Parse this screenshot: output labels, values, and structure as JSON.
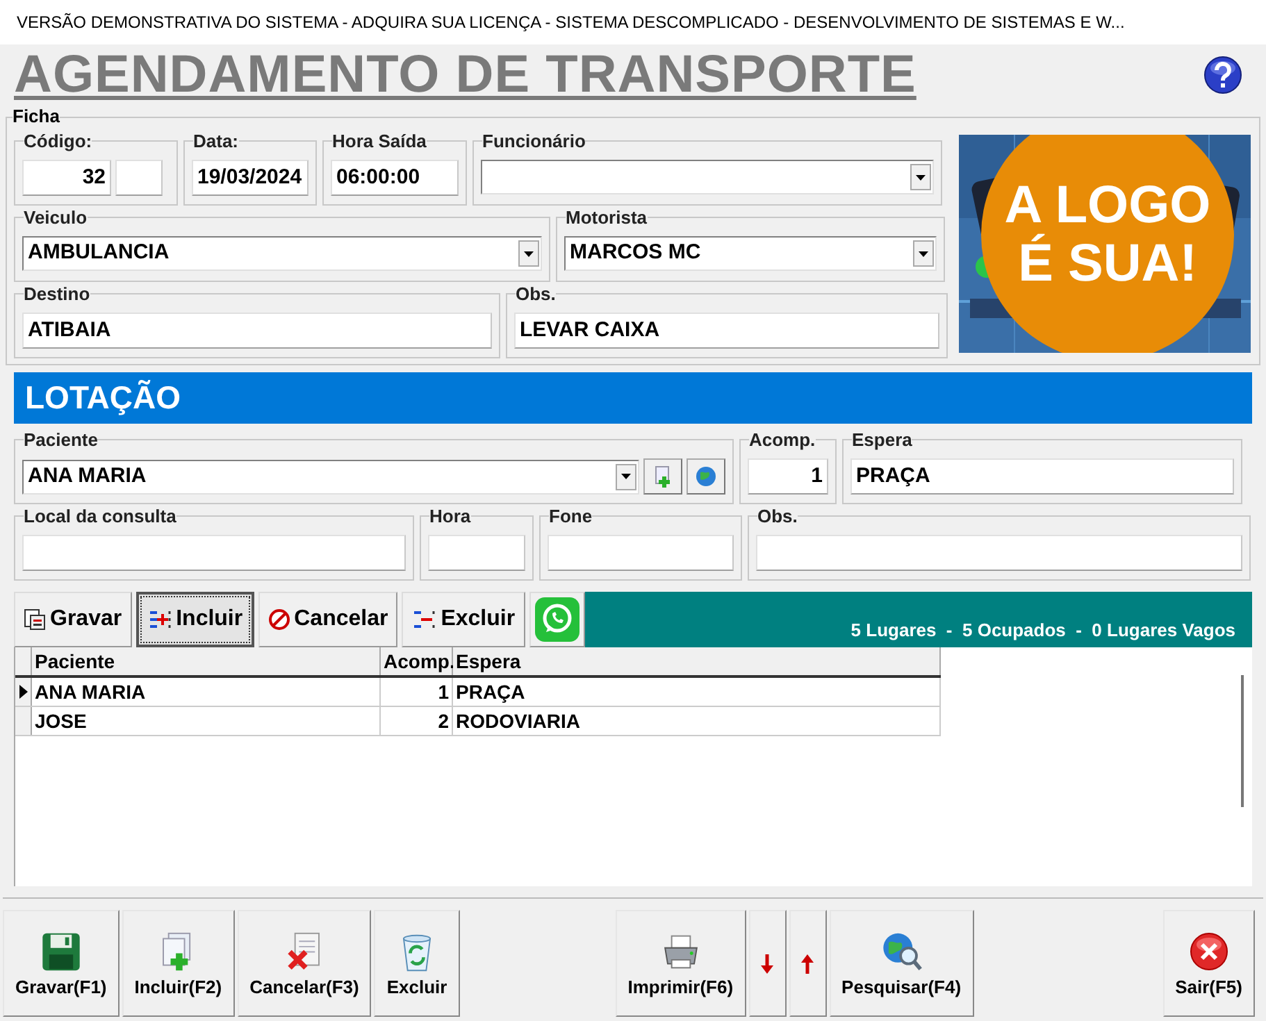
{
  "window": {
    "title": "VERSÃO DEMONSTRATIVA DO SISTEMA - ADQUIRA SUA LICENÇA - SISTEMA DESCOMPLICADO - DESENVOLVIMENTO DE SISTEMAS E W..."
  },
  "heading": "AGENDAMENTO DE TRANSPORTE",
  "ficha": {
    "legend": "Ficha",
    "fields": [
      {
        "label": "Código:",
        "value": "32",
        "kind": "code"
      },
      {
        "label": "Data:",
        "value": "19/03/2024",
        "kind": "text"
      },
      {
        "label": "Hora Saída",
        "value": "06:00:00",
        "kind": "text"
      },
      {
        "label": "Funcionário",
        "kind": "combo"
      },
      {
        "label": "Veiculo",
        "value": "AMBULANCIA",
        "kind": "combo"
      },
      {
        "label": "Motorista",
        "value": "MARCOS MC",
        "kind": "combo"
      },
      {
        "label": "Destino",
        "value": "ATIBAIA",
        "kind": "text"
      },
      {
        "label": "Obs.",
        "value": "LEVAR CAIXA",
        "kind": "text"
      }
    ],
    "logo": {
      "badge_lines": [
        "A LOGO",
        "É SUA!"
      ]
    }
  },
  "lotacao": {
    "title": "LOTAÇÃO",
    "fields": [
      {
        "label": "Paciente",
        "value": "ANA MARIA",
        "kind": "combo_actions"
      },
      {
        "label": "Acomp.",
        "value": "1",
        "kind": "number"
      },
      {
        "label": "Espera",
        "value": "PRAÇA",
        "kind": "text"
      },
      {
        "label": "Local da consulta",
        "kind": "text"
      },
      {
        "label": "Hora",
        "kind": "text"
      },
      {
        "label": "Fone",
        "kind": "text"
      },
      {
        "label": "Obs.",
        "kind": "text"
      }
    ]
  },
  "toolbar": {
    "buttons": [
      {
        "label": "Gravar",
        "selected": false
      },
      {
        "label": "Incluir",
        "selected": true
      },
      {
        "label": "Cancelar",
        "selected": false
      },
      {
        "label": "Excluir",
        "selected": false
      },
      {
        "kind": "chat",
        "selected": false
      }
    ],
    "summary": "5 Lugares  -  5 Ocupados  -  0 Lugares Vagos"
  },
  "grid": {
    "columns": [
      "Paciente",
      "Acomp.",
      "Espera"
    ],
    "rows": [
      {
        "cells": [
          "ANA MARIA",
          "1",
          "PRAÇA"
        ],
        "selected": true
      },
      {
        "cells": [
          "JOSE",
          "2",
          "RODOVIARIA"
        ],
        "selected": false
      }
    ]
  },
  "footer": {
    "left": [
      {
        "label": "Gravar(F1)",
        "kind": "button"
      },
      {
        "label": "Incluir(F2)",
        "kind": "button"
      },
      {
        "label": "Cancelar(F3)",
        "kind": "button"
      },
      {
        "label": "Excluir",
        "kind": "button"
      }
    ],
    "middle": [
      {
        "label": "Imprimir(F6)",
        "kind": "button"
      },
      {
        "kind": "arrow_down"
      },
      {
        "kind": "arrow_up"
      },
      {
        "label": "Pesquisar(F4)",
        "kind": "button"
      }
    ],
    "right": [
      {
        "label": "Sair(F5)",
        "kind": "button"
      }
    ]
  }
}
